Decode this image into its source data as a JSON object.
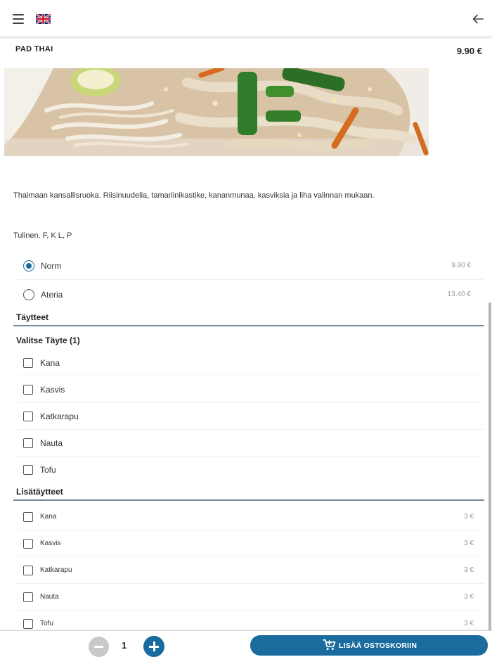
{
  "header": {
    "menu_icon": "hamburger-menu-icon",
    "language_icon": "uk-flag-icon",
    "back_icon": "arrow-left-icon"
  },
  "product": {
    "title": "PAD THAI",
    "price": "9.90 €",
    "description": "Thaimaan kansallisruoka. Riisinuudelia, tamariinikastike, kananmunaa, kasviksia ja liha valinnan mukaan.",
    "allergens": "Tulinen. F, K L, P"
  },
  "sizes": [
    {
      "label": "Norm",
      "price": "9.90 €",
      "selected": true
    },
    {
      "label": "Ateria",
      "price": "13.40 €",
      "selected": false
    }
  ],
  "fillings": {
    "heading": "Täytteet",
    "subheading": "Valitse Täyte (1)",
    "items": [
      "Kana",
      "Kasvis",
      "Katkarapu",
      "Nauta",
      "Tofu"
    ]
  },
  "extras": {
    "heading": "Lisätäytteet",
    "items": [
      {
        "label": "Kana",
        "price": "3 €"
      },
      {
        "label": "Kasvis",
        "price": "3 €"
      },
      {
        "label": "Katkarapu",
        "price": "3 €"
      },
      {
        "label": "Nauta",
        "price": "3 €"
      },
      {
        "label": "Tofu",
        "price": "3 €"
      }
    ]
  },
  "cart": {
    "quantity": "1",
    "add_label": "LISÄÄ OSTOSKORIIN",
    "cart_icon": "shopping-cart-icon"
  },
  "colors": {
    "accent": "#1a6c9e",
    "disabled": "#c9c9c9"
  }
}
